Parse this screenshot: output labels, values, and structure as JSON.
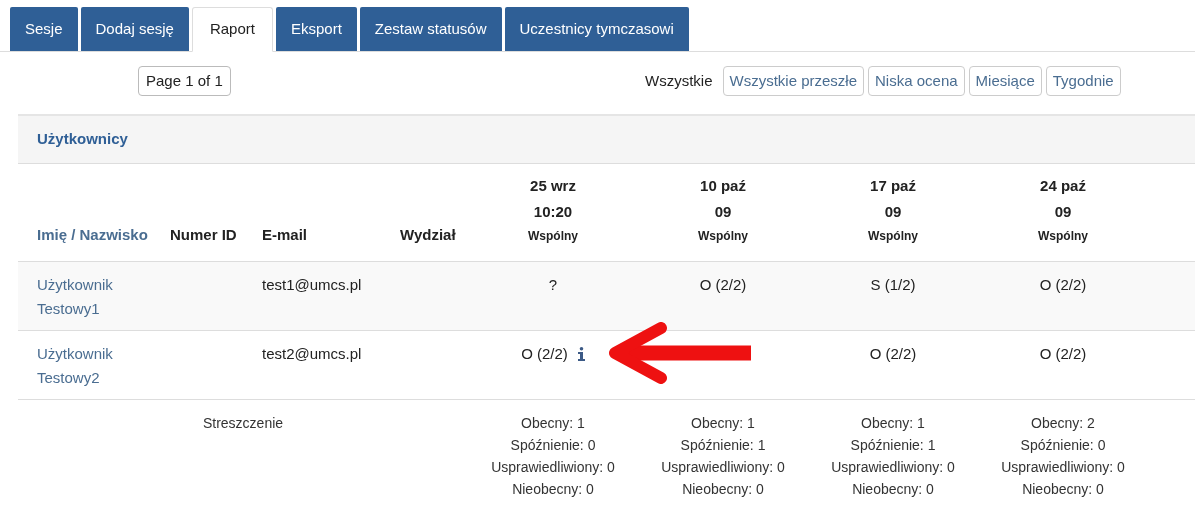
{
  "tabs": [
    {
      "label": "Sesje",
      "selected": false
    },
    {
      "label": "Dodaj sesję",
      "selected": false
    },
    {
      "label": "Raport",
      "selected": true
    },
    {
      "label": "Eksport",
      "selected": false
    },
    {
      "label": "Zestaw statusów",
      "selected": false
    },
    {
      "label": "Uczestnicy tymczasowi",
      "selected": false
    }
  ],
  "pager": "Page 1 of 1",
  "filter_label": "Wszystkie",
  "filters": [
    "Wszystkie przeszłe",
    "Niska ocena",
    "Miesiące",
    "Tygodnie"
  ],
  "table": {
    "caption": "Użytkownicy",
    "name_header": {
      "first": "Imię",
      "separator": " / ",
      "last": "Nazwisko"
    },
    "columns": [
      "Numer ID",
      "E-mail",
      "Wydział"
    ],
    "sessions": [
      {
        "date": "25 wrz",
        "time": "10:20",
        "group": "Wspólny"
      },
      {
        "date": "10 paź",
        "time": "09",
        "group": "Wspólny"
      },
      {
        "date": "17 paź",
        "time": "09",
        "group": "Wspólny"
      },
      {
        "date": "24 paź",
        "time": "09",
        "group": "Wspólny"
      }
    ],
    "rows": [
      {
        "name": "Użytkownik Testowy1",
        "email": "test1@umcs.pl",
        "cells": [
          {
            "text": "?",
            "info": false
          },
          {
            "text": "O (2/2)",
            "info": false
          },
          {
            "text": "S (1/2)",
            "info": false
          },
          {
            "text": "O (2/2)",
            "info": false
          }
        ]
      },
      {
        "name": "Użytkownik Testowy2",
        "email": "test2@umcs.pl",
        "cells": [
          {
            "text": "O (2/2)",
            "info": true
          },
          {
            "covered": true
          },
          {
            "text": "O (2/2)",
            "info": false
          },
          {
            "text": "O (2/2)",
            "info": false
          }
        ]
      }
    ],
    "summary_label": "Streszczenie",
    "summary": [
      [
        "Obecny: 1",
        "Spóźnienie: 0",
        "Usprawiedliwiony: 0",
        "Nieobecny: 0"
      ],
      [
        "Obecny: 1",
        "Spóźnienie: 1",
        "Usprawiedliwiony: 0",
        "Nieobecny: 0"
      ],
      [
        "Obecny: 1",
        "Spóźnienie: 1",
        "Usprawiedliwiony: 0",
        "Nieobecny: 0"
      ],
      [
        "Obecny: 2",
        "Spóźnienie: 0",
        "Usprawiedliwiony: 0",
        "Nieobecny: 0"
      ]
    ]
  },
  "annotation": {
    "kind": "arrow"
  }
}
